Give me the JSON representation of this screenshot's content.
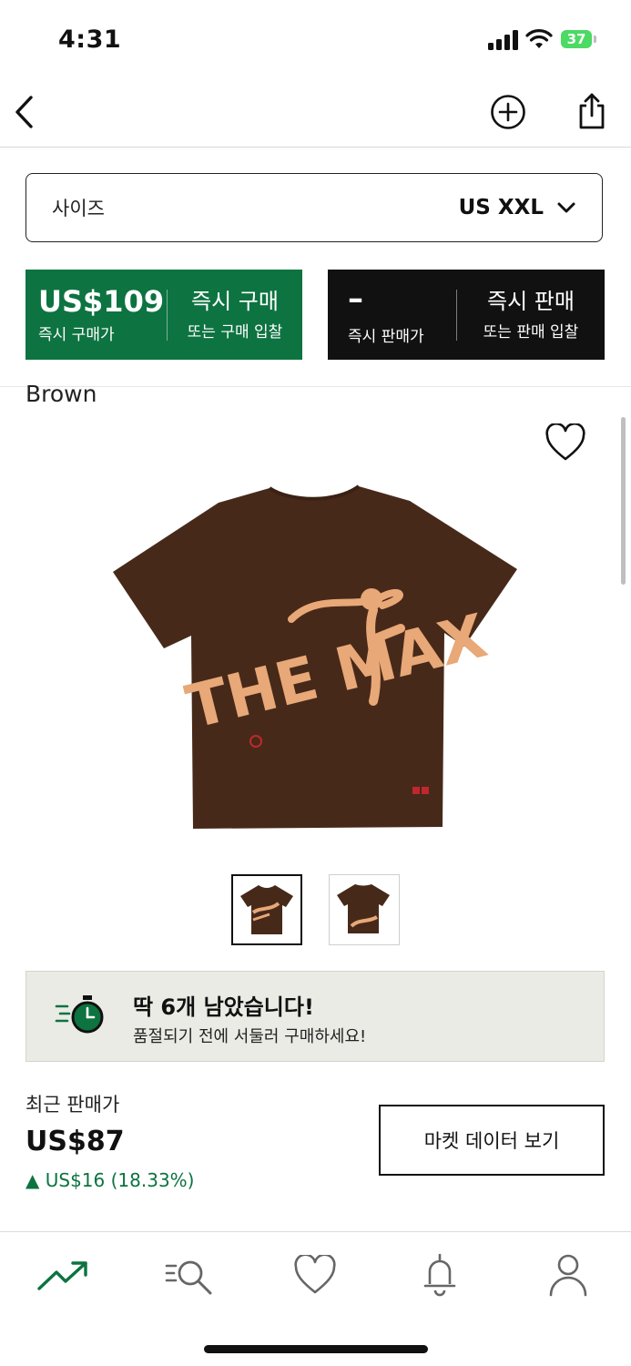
{
  "status_bar": {
    "time": "4:31",
    "battery": "37"
  },
  "header": {
    "back_icon": "chevron-left-icon",
    "add_icon": "plus-circle-icon",
    "share_icon": "share-icon"
  },
  "size_selector": {
    "label": "사이즈",
    "value": "US XXL"
  },
  "buy": {
    "price": "US$109",
    "price_caption": "즉시 구매가",
    "action": "즉시 구매",
    "action_sub": "또는 구매 입찰",
    "color": "#0d7341"
  },
  "sell": {
    "price": "–",
    "price_caption": "즉시 판매가",
    "action": "즉시 판매",
    "action_sub": "또는 판매 입찰",
    "color": "#111111"
  },
  "product": {
    "color_name": "Brown",
    "graphic_text": "THE MAX"
  },
  "stock_notice": {
    "title": "딱 6개 남았습니다!",
    "subtitle": "품절되기 전에 서둘러 구매하세요!"
  },
  "recent_sale": {
    "label": "최근 판매가",
    "price": "US$87",
    "change": "▲ US$16 (18.33%)",
    "market_button": "마켓 데이터 보기"
  },
  "tab_bar": {
    "items": [
      "trending-icon",
      "search-icon",
      "heart-icon",
      "bell-icon",
      "profile-icon"
    ],
    "active_color": "#0d7341"
  }
}
